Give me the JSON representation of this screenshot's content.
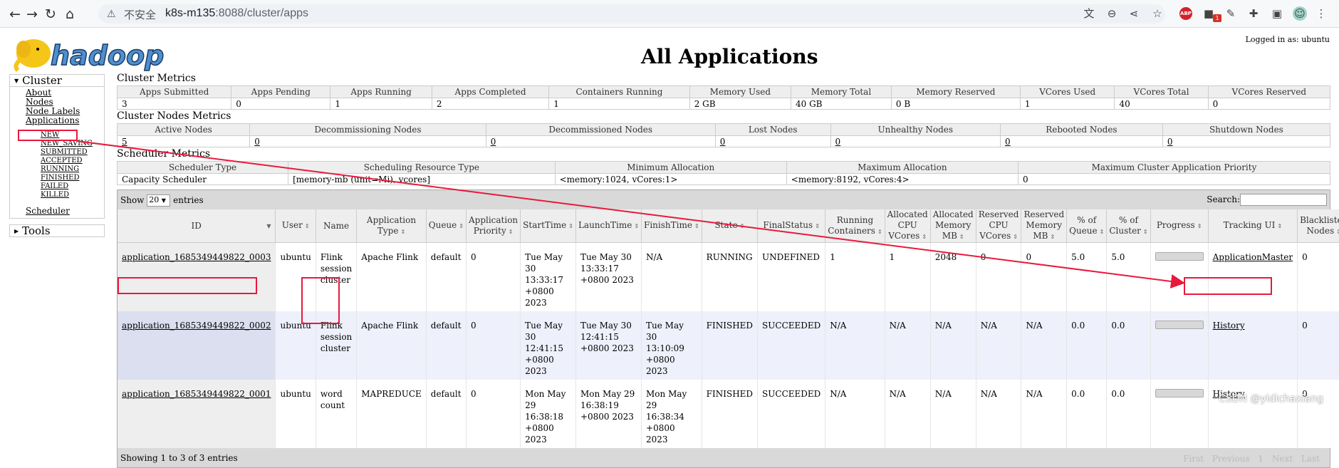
{
  "browser": {
    "insecure_label": "不安全",
    "url_host": "k8s-m135",
    "url_rest": ":8088/cluster/apps"
  },
  "header": {
    "title": "All Applications",
    "login": "Logged in as: ubuntu"
  },
  "sidebar": {
    "cluster_label": "Cluster",
    "about": "About",
    "nodes": "Nodes",
    "node_labels": "Node Labels",
    "applications": "Applications",
    "states": [
      "NEW",
      "NEW_SAVING",
      "SUBMITTED",
      "ACCEPTED",
      "RUNNING",
      "FINISHED",
      "FAILED",
      "KILLED"
    ],
    "scheduler": "Scheduler",
    "tools_label": "Tools"
  },
  "cluster_metrics": {
    "title": "Cluster Metrics",
    "headers": [
      "Apps Submitted",
      "Apps Pending",
      "Apps Running",
      "Apps Completed",
      "Containers Running",
      "Memory Used",
      "Memory Total",
      "Memory Reserved",
      "VCores Used",
      "VCores Total",
      "VCores Reserved"
    ],
    "values": [
      "3",
      "0",
      "1",
      "2",
      "1",
      "2 GB",
      "40 GB",
      "0 B",
      "1",
      "40",
      "0"
    ]
  },
  "nodes_metrics": {
    "title": "Cluster Nodes Metrics",
    "headers": [
      "Active Nodes",
      "Decommissioning Nodes",
      "Decommissioned Nodes",
      "Lost Nodes",
      "Unhealthy Nodes",
      "Rebooted Nodes",
      "Shutdown Nodes"
    ],
    "values": [
      "5",
      "0",
      "0",
      "0",
      "0",
      "0",
      "0"
    ]
  },
  "scheduler_metrics": {
    "title": "Scheduler Metrics",
    "headers": [
      "Scheduler Type",
      "Scheduling Resource Type",
      "Minimum Allocation",
      "Maximum Allocation",
      "Maximum Cluster Application Priority"
    ],
    "values": [
      "Capacity Scheduler",
      "[memory-mb (unit=Mi), vcores]",
      "<memory:1024, vCores:1>",
      "<memory:8192, vCores:4>",
      "0"
    ]
  },
  "apps": {
    "show_label": "Show",
    "show_value": "20",
    "entries_label": "entries",
    "search_label": "Search:",
    "headers": [
      "ID",
      "User",
      "Name",
      "Application Type",
      "Queue",
      "Application Priority",
      "StartTime",
      "LaunchTime",
      "FinishTime",
      "State",
      "FinalStatus",
      "Running Containers",
      "Allocated CPU VCores",
      "Allocated Memory MB",
      "Reserved CPU VCores",
      "Reserved Memory MB",
      "% of Queue",
      "% of Cluster",
      "Progress",
      "Tracking UI",
      "Blacklisted Nodes"
    ],
    "rows": [
      [
        "application_1685349449822_0003",
        "ubuntu",
        "Flink session cluster",
        "Apache Flink",
        "default",
        "0",
        "Tue May 30 13:33:17 +0800 2023",
        "Tue May 30 13:33:17 +0800 2023",
        "N/A",
        "RUNNING",
        "UNDEFINED",
        "1",
        "1",
        "2048",
        "0",
        "0",
        "5.0",
        "5.0",
        "",
        "ApplicationMaster",
        "0"
      ],
      [
        "application_1685349449822_0002",
        "ubuntu",
        "Flink session cluster",
        "Apache Flink",
        "default",
        "0",
        "Tue May 30 12:41:15 +0800 2023",
        "Tue May 30 12:41:15 +0800 2023",
        "Tue May 30 13:10:09 +0800 2023",
        "FINISHED",
        "SUCCEEDED",
        "N/A",
        "N/A",
        "N/A",
        "N/A",
        "N/A",
        "0.0",
        "0.0",
        "",
        "History",
        "0"
      ],
      [
        "application_1685349449822_0001",
        "ubuntu",
        "word count",
        "MAPREDUCE",
        "default",
        "0",
        "Mon May 29 16:38:18 +0800 2023",
        "Mon May 29 16:38:19 +0800 2023",
        "Mon May 29 16:38:34 +0800 2023",
        "FINISHED",
        "SUCCEEDED",
        "N/A",
        "N/A",
        "N/A",
        "N/A",
        "N/A",
        "0.0",
        "0.0",
        "",
        "History",
        "0"
      ]
    ],
    "info": "Showing 1 to 3 of 3 entries",
    "paging": [
      "First",
      "Previous",
      "1",
      "Next",
      "Last"
    ]
  },
  "watermark": "CSDN @yidichaxiang",
  "colors": {
    "annotation": "#e8193e",
    "header_bg": "#eeeeee",
    "bar_bg": "#d9d9d9"
  }
}
